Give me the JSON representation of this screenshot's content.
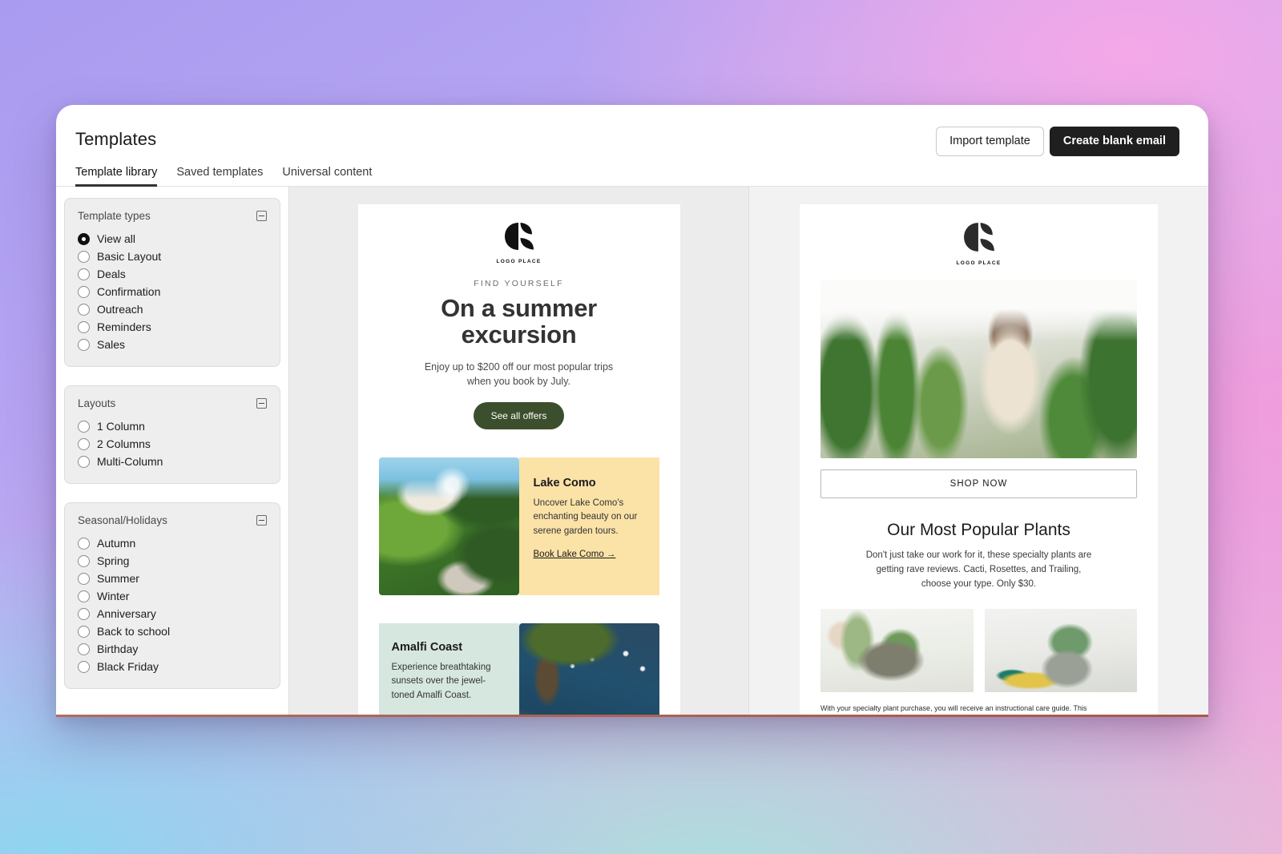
{
  "header": {
    "title": "Templates",
    "import_label": "Import template",
    "create_label": "Create blank email"
  },
  "tabs": [
    {
      "label": "Template library",
      "active": true
    },
    {
      "label": "Saved templates",
      "active": false
    },
    {
      "label": "Universal content",
      "active": false
    }
  ],
  "sidebar": {
    "groups": [
      {
        "title": "Template types",
        "collapse_icon": "collapse-minus-icon",
        "options": [
          {
            "label": "View all",
            "checked": true
          },
          {
            "label": "Basic Layout",
            "checked": false
          },
          {
            "label": "Deals",
            "checked": false
          },
          {
            "label": "Confirmation",
            "checked": false
          },
          {
            "label": "Outreach",
            "checked": false
          },
          {
            "label": "Reminders",
            "checked": false
          },
          {
            "label": "Sales",
            "checked": false
          }
        ]
      },
      {
        "title": "Layouts",
        "collapse_icon": "collapse-minus-icon",
        "options": [
          {
            "label": "1 Column",
            "checked": false
          },
          {
            "label": "2 Columns",
            "checked": false
          },
          {
            "label": "Multi-Column",
            "checked": false
          }
        ]
      },
      {
        "title": "Seasonal/Holidays",
        "collapse_icon": "collapse-minus-icon",
        "options": [
          {
            "label": "Autumn",
            "checked": false
          },
          {
            "label": "Spring",
            "checked": false
          },
          {
            "label": "Summer",
            "checked": false
          },
          {
            "label": "Winter",
            "checked": false
          },
          {
            "label": "Anniversary",
            "checked": false
          },
          {
            "label": "Back to school",
            "checked": false
          },
          {
            "label": "Birthday",
            "checked": false
          },
          {
            "label": "Black Friday",
            "checked": false
          }
        ]
      }
    ]
  },
  "template_a": {
    "logo_text": "LOGO PLACE",
    "eyebrow": "FIND YOURSELF",
    "headline_line1": "On a summer",
    "headline_line2": "excursion",
    "subcopy": "Enjoy up to $200 off our most popular trips when you book by July.",
    "cta_label": "See all offers",
    "destinations": [
      {
        "title": "Lake Como",
        "text": "Uncover Lake Como's enchanting beauty on our serene garden tours.",
        "link": "Book Lake Como →",
        "accent": "#fbe2a7",
        "image_name": "lake-como-photo"
      },
      {
        "title": "Amalfi Coast",
        "text": "Experience breathtaking sunsets over the jewel-toned Amalfi Coast.",
        "link": "",
        "accent": "#d6e7e0",
        "image_name": "amalfi-coast-photo"
      }
    ]
  },
  "template_b": {
    "logo_text": "LOGO PLACE",
    "hero_image_name": "greenhouse-woman-cactus-photo",
    "shop_label": "SHOP NOW",
    "section_title": "Our Most Popular Plants",
    "section_copy": "Don't just take our work for it, these specialty plants are getting rave reviews. Cacti, Rosettes, and Trailing, choose your type. Only $30.",
    "grid_images": [
      "watering-succulent-bowl-photo",
      "potted-cactus-photo"
    ],
    "fineprint": "With your specialty plant purchase, you will receive an instructional care guide. This"
  },
  "colors": {
    "accent_dark": "#1f1f1f",
    "cta_green": "#3c4f2c",
    "card_yellow": "#fbe2a7",
    "card_mint": "#d6e7e0",
    "panel_gray": "#eeeeef"
  }
}
